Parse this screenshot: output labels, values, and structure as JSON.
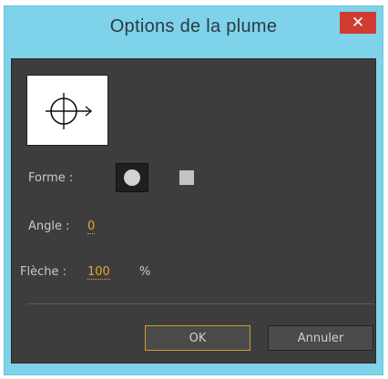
{
  "window": {
    "title": "Options de la plume",
    "close_icon": "close-icon",
    "close_symbol": "✕"
  },
  "preview": {
    "icon": "crosshair-arrow-icon"
  },
  "form": {
    "shape_label": "Forme :",
    "shape_options": [
      {
        "name": "round",
        "icon": "round-brush-icon",
        "selected": true
      },
      {
        "name": "square",
        "icon": "square-brush-icon",
        "selected": false
      }
    ],
    "angle_label": "Angle :",
    "angle_value": "0",
    "arrow_label": "Flèche :",
    "arrow_value": "100",
    "arrow_unit": "%"
  },
  "buttons": {
    "ok": "OK",
    "cancel": "Annuler"
  },
  "colors": {
    "title_bar": "#7ed3ea",
    "panel": "#3d3d3d",
    "accent": "#e3a530",
    "close": "#cf3c31"
  }
}
